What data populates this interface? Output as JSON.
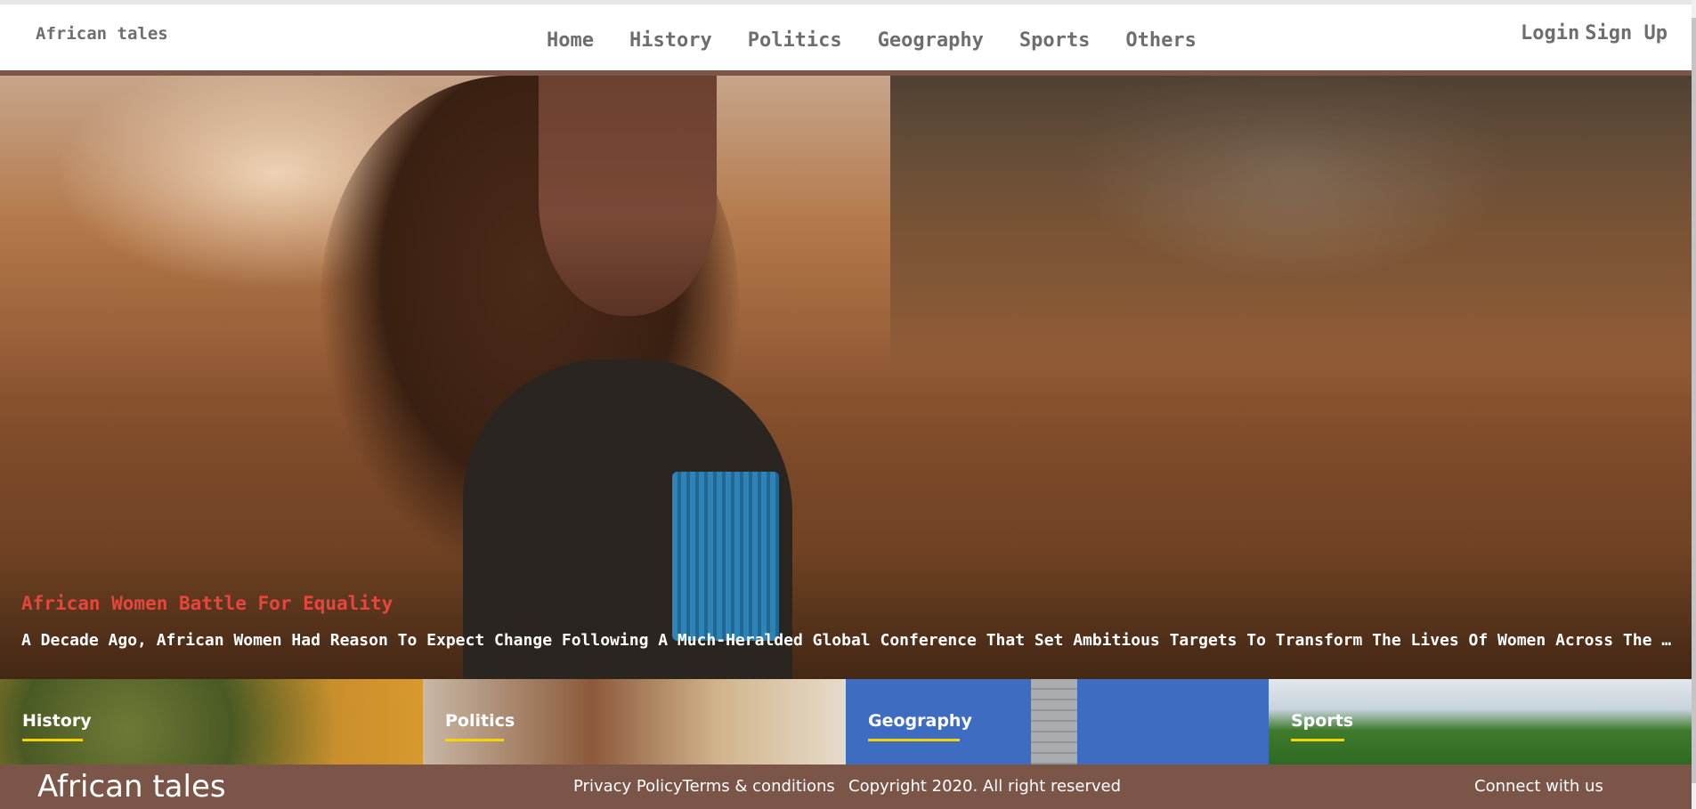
{
  "brand": "African tales",
  "nav": {
    "items": [
      {
        "label": "Home"
      },
      {
        "label": "History"
      },
      {
        "label": "Politics"
      },
      {
        "label": "Geography"
      },
      {
        "label": "Sports"
      },
      {
        "label": "Others"
      }
    ]
  },
  "auth": {
    "login": "Login",
    "signup": "Sign Up"
  },
  "hero": {
    "title": "African Women Battle For Equality",
    "description": "A Decade Ago, African Women Had Reason To Expect Change Following A Much-Heralded Global Conference That Set Ambitious Targets To Transform The Lives Of Women Across The Continent"
  },
  "categories": [
    {
      "label": "History"
    },
    {
      "label": "Politics"
    },
    {
      "label": "Geography"
    },
    {
      "label": "Sports"
    }
  ],
  "footer": {
    "brand": "African tales",
    "privacy": "Privacy Policy",
    "terms": "Terms & conditions",
    "copyright": "Copyright 2020. All right reserved",
    "connect": "Connect with us"
  },
  "colors": {
    "accent": "#7a5548",
    "hero_title": "#e8453c",
    "underline": "#f5d400",
    "nav_text": "#6e6e6e"
  }
}
